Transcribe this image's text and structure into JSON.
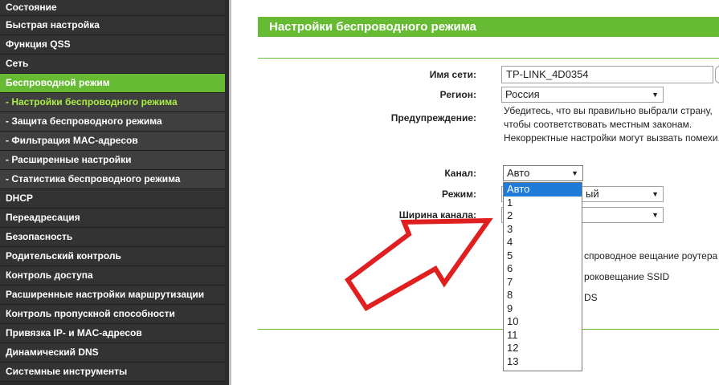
{
  "sidebar": {
    "items": [
      {
        "label": "Состояние"
      },
      {
        "label": "Быстрая настройка"
      },
      {
        "label": "Функция QSS"
      },
      {
        "label": "Сеть"
      },
      {
        "label": "Беспроводной режим"
      },
      {
        "label": "- Настройки беспроводного режима"
      },
      {
        "label": "- Защита беспроводного режима"
      },
      {
        "label": "- Фильтрация MAC-адресов"
      },
      {
        "label": "- Расширенные настройки"
      },
      {
        "label": "- Статистика беспроводного режима"
      },
      {
        "label": "DHCP"
      },
      {
        "label": "Переадресация"
      },
      {
        "label": "Безопасность"
      },
      {
        "label": "Родительский контроль"
      },
      {
        "label": "Контроль доступа"
      },
      {
        "label": "Расширенные настройки маршрутизации"
      },
      {
        "label": "Контроль пропускной способности"
      },
      {
        "label": "Привязка IP- и MAC-адресов"
      },
      {
        "label": "Динамический DNS"
      },
      {
        "label": "Системные инструменты"
      }
    ]
  },
  "header": {
    "title": "Настройки беспроводного режима"
  },
  "form": {
    "ssid": {
      "label": "Имя сети:",
      "value": "TP-LINK_4D0354"
    },
    "region": {
      "label": "Регион:",
      "value": "Россия"
    },
    "warning": {
      "label": "Предупреждение:",
      "lines": [
        "Убедитесь, что вы правильно выбрали страну,",
        "чтобы соответствовать местным законам.",
        "Некорректные настройки могут вызвать помехи."
      ]
    },
    "channel": {
      "label": "Канал:",
      "value": "Авто"
    },
    "mode": {
      "label": "Режим:",
      "value_partial": "ый"
    },
    "width": {
      "label": "Ширина канала:"
    },
    "options": {
      "broadcast_partial": "спроводное вещание роутера",
      "ssid_partial": "роковещание SSID",
      "wds_partial": "DS"
    }
  },
  "channel_dropdown": {
    "options": [
      "Авто",
      "1",
      "2",
      "3",
      "4",
      "5",
      "6",
      "7",
      "8",
      "9",
      "10",
      "11",
      "12",
      "13"
    ],
    "selected_index": 0
  },
  "colors": {
    "accent_green": "#66bb33",
    "sidebar_bg": "#333333",
    "annotation_red": "#e02020",
    "highlight_blue": "#1e7bd8"
  }
}
